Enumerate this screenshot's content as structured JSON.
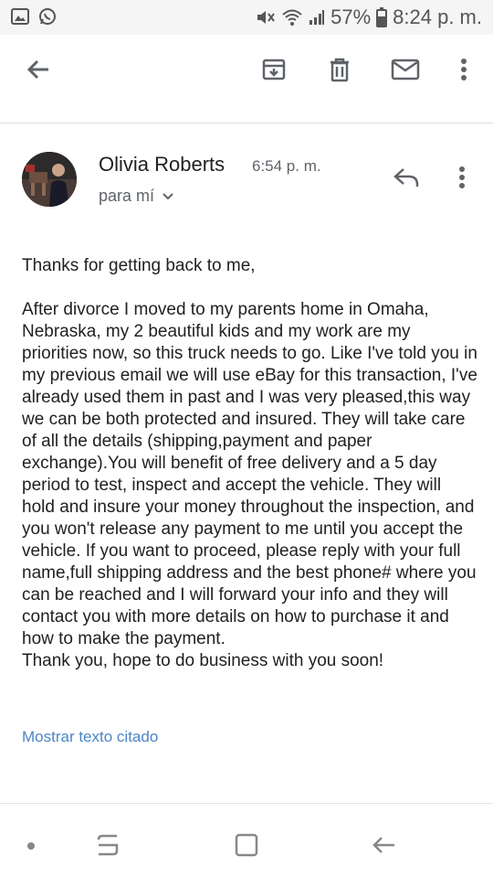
{
  "status_bar": {
    "battery_percent": "57%",
    "time": "8:24 p. m."
  },
  "toolbar": {
    "icons": [
      "back-arrow-icon",
      "archive-icon",
      "delete-icon",
      "mail-icon",
      "more-vert-icon"
    ]
  },
  "email": {
    "sender_name": "Olivia Roberts",
    "time": "6:54 p. m.",
    "recipient": "para mí",
    "greeting": "Thanks for getting back to me,",
    "paragraph": "After divorce I moved to my parents home in Omaha, Nebraska, my 2 beautiful kids and my work are my priorities now, so this truck needs to go. Like I've told you in my previous email we will use eBay for this transaction, I've already used them in past and I was very pleased,this way we can be both protected and insured. They will take care of all the details (shipping,payment and paper exchange).You will benefit of free delivery and a 5 day period to test, inspect and accept the vehicle. They will hold and insure your money throughout the inspection, and you won't release any payment to me until you accept the vehicle. If you want to proceed, please reply with your full name,full shipping address and the best phone# where you can be reached and I will forward your info and they will contact you with more details on how to purchase it and how to make the payment.",
    "closing": "Thank you, hope to do business with you soon!",
    "show_quoted": "Mostrar texto citado"
  },
  "colors": {
    "link": "#4a86c5",
    "icon": "#5f6368"
  }
}
